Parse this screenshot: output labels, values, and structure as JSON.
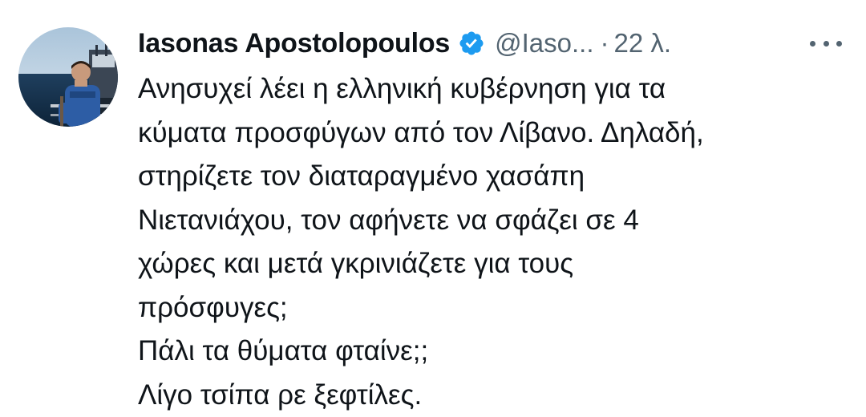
{
  "tweet": {
    "author": {
      "display_name": "Iasonas Apostolopoulos",
      "verified_icon": "verified-badge-icon",
      "handle": "@Iaso...",
      "separator": "·",
      "time": "22 λ."
    },
    "more_icon": "more-horizontal-icon",
    "avatar_icon": "profile-photo",
    "text_lines": [
      "Ανησυχεί λέει η ελληνική κυβέρνηση για τα",
      "κύματα προσφύγων από τον Λίβανο. Δηλαδή,",
      "στηρίζετε τον διαταραγμένο χασάπη",
      "Νιετανιάχου, τον αφήνετε να σφάζει σε 4",
      "χώρες και μετά γκρινιάζετε για τους",
      "πρόσφυγες;",
      "Πάλι τα θύματα φταίνε;;",
      "Λίγο τσίπα ρε ξεφτίλες."
    ]
  },
  "colors": {
    "text_primary": "#0f1419",
    "text_secondary": "#536471",
    "verified_blue": "#1d9bf0",
    "background": "#ffffff"
  }
}
